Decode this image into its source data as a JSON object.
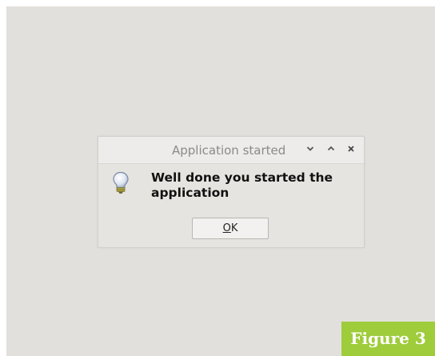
{
  "dialog": {
    "title": "Application started",
    "message": "Well done you started the application",
    "ok_label_mnemonic": "O",
    "ok_label_rest": "K",
    "icon": "lightbulb-icon",
    "window_controls": [
      "minimize-icon",
      "maximize-icon",
      "close-icon"
    ]
  },
  "figure_label": "Figure 3",
  "colors": {
    "desktop_background": "#e2e0dc",
    "dialog_background": "#e6e4e0",
    "figure_label_background": "#9fcc3b"
  }
}
